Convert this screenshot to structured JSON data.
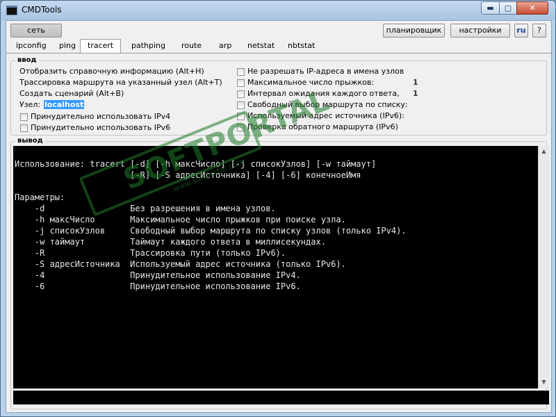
{
  "window": {
    "title": "CMDTools",
    "min_glyph": "▬",
    "max_glyph": "▢",
    "close_glyph": "✕"
  },
  "toolbar": {
    "net_label": "сеть",
    "scheduler_label": "планировщик",
    "settings_label": "настройки",
    "lang_label": "ru",
    "help_label": "?"
  },
  "tabs": [
    "ipconfig",
    "ping",
    "tracert",
    "pathping",
    "route",
    "arp",
    "netstat",
    "nbtstat"
  ],
  "active_tab": "tracert",
  "input": {
    "group_label": "ввод",
    "left_options": [
      "Отобразить справочную информацию (Alt+H)",
      "Трассировка маршрута на указанный узел (Alt+T)",
      "Создать сценарий (Alt+B)"
    ],
    "host_label": "Узел:",
    "host_value": "localhost",
    "left_checkboxes": [
      "Принудительно использовать IPv4",
      "Принудительно использовать IPv6"
    ],
    "right_checkboxes": [
      "Не разрешать IP-адреса в имена узлов",
      "Максимальное число прыжков:",
      "Интервал ожидания каждого ответа,",
      "Свободный выбор маршрута по списку:",
      "Используемый адрес источника (IPv6):",
      "Проверка обратного маршрута (IPv6)"
    ],
    "max_hops": "1",
    "timeout": "1"
  },
  "output": {
    "group_label": "вывод",
    "lines": [
      "Использование: tracert [-d] [-h максЧисло] [-j списокУзлов] [-w таймаут]",
      "                       [-R] [-S адресИсточника] [-4] [-6] конечноеИмя",
      "",
      "Параметры:",
      "    -d                 Без разрешения в имена узлов.",
      "    -h максЧисло       Максимальное число прыжков при поиске узла.",
      "    -j списокУзлов     Свободный выбор маршрута по списку узлов (только IPv4).",
      "    -w таймаут         Таймаут каждого ответа в миллисекундах.",
      "    -R                 Трассировка пути (только IPv6).",
      "    -S адресИсточника  Используемый адрес источника (только IPv6).",
      "    -4                 Принудительное использование IPv4.",
      "    -6                 Принудительное использование IPv6."
    ],
    "scroll_up_glyph": "▲",
    "scroll_down_glyph": "▼"
  },
  "watermark": {
    "main": "SOFTPORTAL",
    "sub": "www.softportal.com"
  }
}
